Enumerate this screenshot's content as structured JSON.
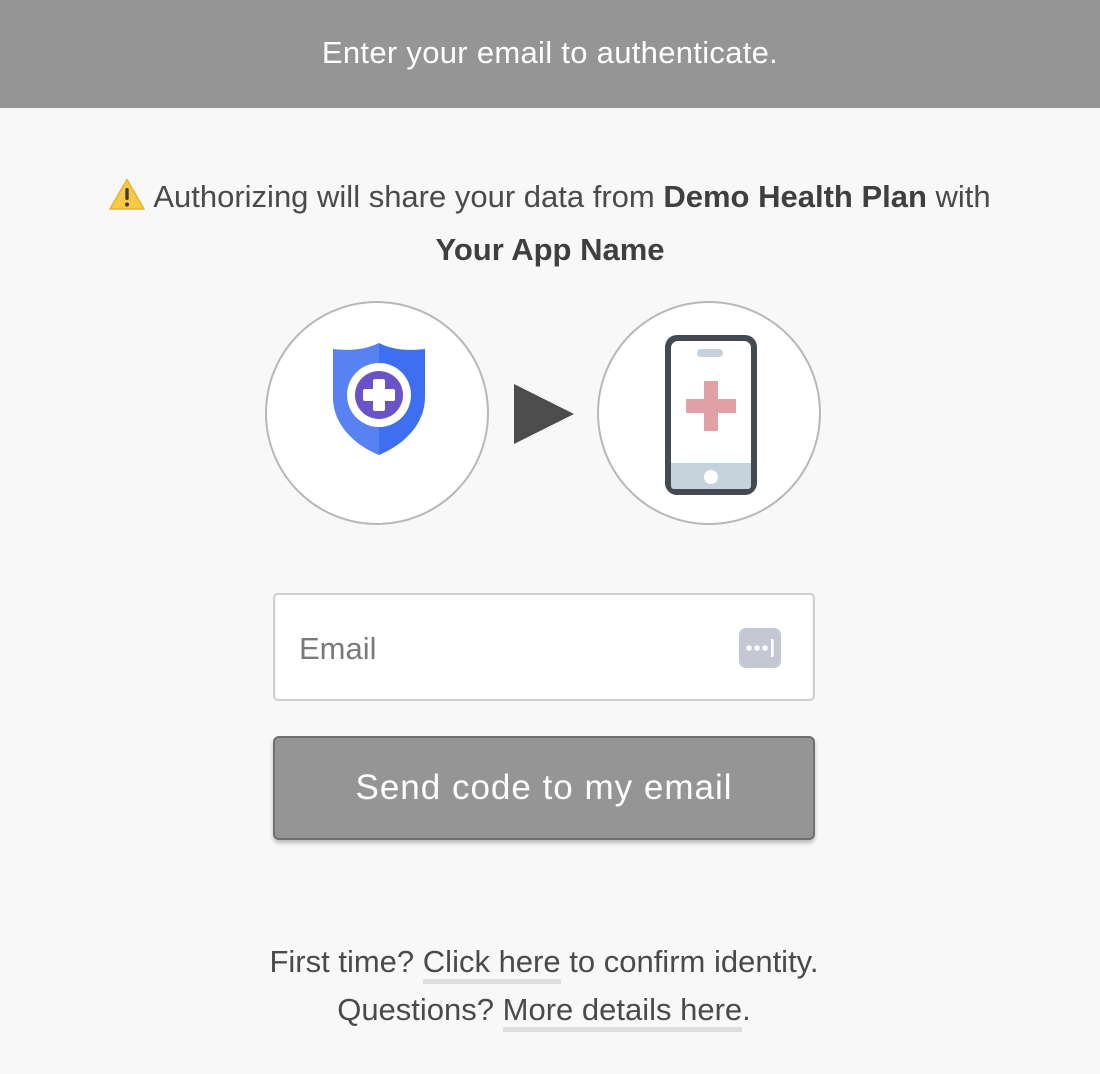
{
  "header": {
    "title": "Enter your email to authenticate."
  },
  "warning": {
    "icon": "warning-icon",
    "prefix": "Authorizing will share your data from",
    "provider": "Demo Health Plan",
    "middle": "with",
    "app_name": "Your App Name"
  },
  "graphic": {
    "left_icon": "health-shield-icon",
    "arrow_icon": "play-arrow-icon",
    "right_icon": "phone-medical-icon"
  },
  "form": {
    "email_placeholder": "Email",
    "email_value": "",
    "autofill_icon": "password-autofill-icon",
    "send_label": "Send code to my email"
  },
  "footer": {
    "line1_prefix": "First time?",
    "line1_link": "Click here",
    "line1_suffix": "to confirm identity.",
    "line2_prefix": "Questions?",
    "line2_link": "More details here",
    "line2_suffix": "."
  },
  "colors": {
    "header_bg": "#959595",
    "button_bg": "#959595",
    "page_bg": "#f8f8f8",
    "shield_blue": "#3d6ff0",
    "cross_red": "#e0a0a5"
  }
}
